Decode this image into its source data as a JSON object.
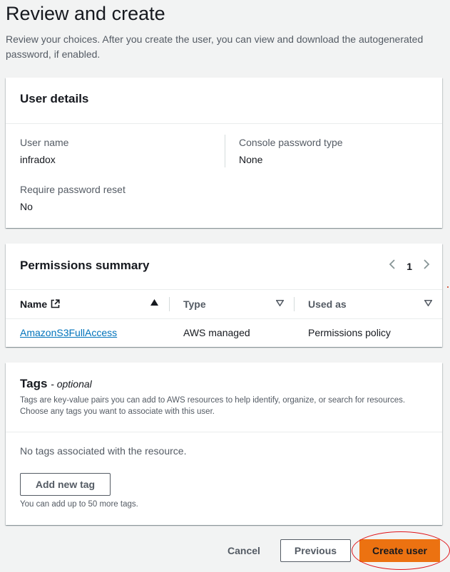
{
  "page": {
    "title": "Review and create",
    "description": "Review your choices. After you create the user, you can view and download the autogenerated password, if enabled."
  },
  "user_details": {
    "heading": "User details",
    "user_name_label": "User name",
    "user_name_value": "infradox",
    "console_password_type_label": "Console password type",
    "console_password_type_value": "None",
    "require_reset_label": "Require password reset",
    "require_reset_value": "No"
  },
  "permissions": {
    "heading": "Permissions summary",
    "page_number": "1",
    "columns": {
      "name": "Name",
      "type": "Type",
      "used_as": "Used as"
    },
    "rows": [
      {
        "name": "AmazonS3FullAccess",
        "type": "AWS managed",
        "used_as": "Permissions policy"
      }
    ]
  },
  "tags": {
    "heading": "Tags",
    "optional_label": "- optional",
    "description": "Tags are key-value pairs you can add to AWS resources to help identify, organize, or search for resources. Choose any tags you want to associate with this user.",
    "empty_text": "No tags associated with the resource.",
    "add_button": "Add new tag",
    "hint": "You can add up to 50 more tags."
  },
  "footer": {
    "cancel": "Cancel",
    "previous": "Previous",
    "create": "Create user"
  },
  "colors": {
    "primary_button": "#ec7211",
    "link": "#0073bb",
    "highlight_ring": "#e0151b"
  }
}
